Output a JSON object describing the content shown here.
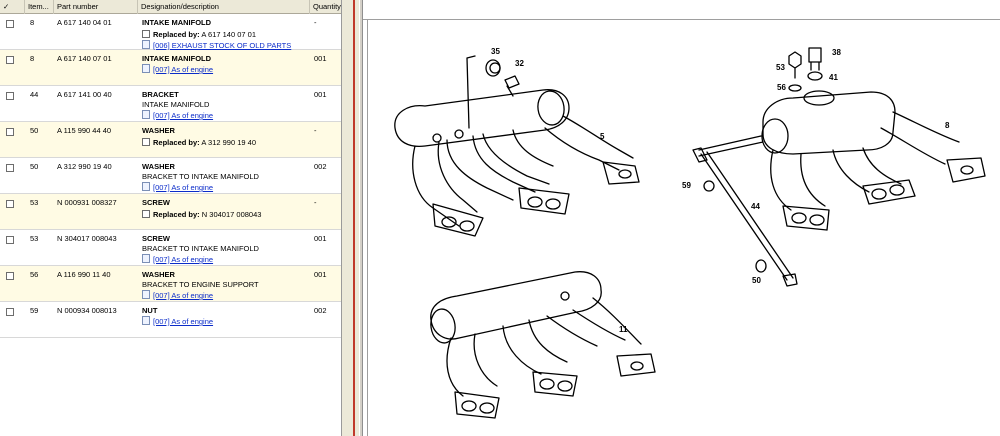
{
  "columns": {
    "check": "✓",
    "item": "Item...",
    "part": "Part number",
    "desc": "Designation/description",
    "qty": "Quantity"
  },
  "rows": [
    {
      "item": "8",
      "part": "A 617 140 04 01",
      "title": "INTAKE MANIFOLD",
      "sub": "",
      "qty": "-",
      "repl_label": "Replaced by:",
      "repl_part": "A 617 140 07 01",
      "link": "[006] EXHAUST STOCK OF OLD PARTS",
      "alt": false
    },
    {
      "item": "8",
      "part": "A 617 140 07 01",
      "title": "INTAKE MANIFOLD",
      "sub": "",
      "qty": "001",
      "repl_label": "",
      "repl_part": "",
      "link": "[007] As of engine",
      "alt": true
    },
    {
      "item": "44",
      "part": "A 617 141 00 40",
      "title": "BRACKET",
      "sub": "INTAKE MANIFOLD",
      "qty": "001",
      "repl_label": "",
      "repl_part": "",
      "link": "[007] As of engine",
      "alt": false
    },
    {
      "item": "50",
      "part": "A 115 990 44 40",
      "title": "WASHER",
      "sub": "",
      "qty": "-",
      "repl_label": "Replaced by:",
      "repl_part": "A 312 990 19 40",
      "link": "",
      "alt": true
    },
    {
      "item": "50",
      "part": "A 312 990 19 40",
      "title": "WASHER",
      "sub": "BRACKET TO INTAKE MANIFOLD",
      "qty": "002",
      "repl_label": "",
      "repl_part": "",
      "link": "[007] As of engine",
      "alt": false
    },
    {
      "item": "53",
      "part": "N 000931 008327",
      "title": "SCREW",
      "sub": "",
      "qty": "-",
      "repl_label": "Replaced by:",
      "repl_part": "N 304017 008043",
      "link": "",
      "alt": true
    },
    {
      "item": "53",
      "part": "N 304017 008043",
      "title": "SCREW",
      "sub": "BRACKET TO INTAKE MANIFOLD",
      "qty": "001",
      "repl_label": "",
      "repl_part": "",
      "link": "[007] As of engine",
      "alt": false
    },
    {
      "item": "56",
      "part": "A 116 990 11 40",
      "title": "WASHER",
      "sub": "BRACKET TO ENGINE SUPPORT",
      "qty": "001",
      "repl_label": "",
      "repl_part": "",
      "link": "[007] As of engine",
      "alt": true
    },
    {
      "item": "59",
      "part": "N 000934 008013",
      "title": "NUT",
      "sub": "",
      "qty": "002",
      "repl_label": "",
      "repl_part": "",
      "link": "[007] As of engine",
      "alt": false
    }
  ],
  "callouts": [
    "35",
    "32",
    "5",
    "53",
    "38",
    "41",
    "56",
    "8",
    "59",
    "44",
    "50",
    "11"
  ]
}
